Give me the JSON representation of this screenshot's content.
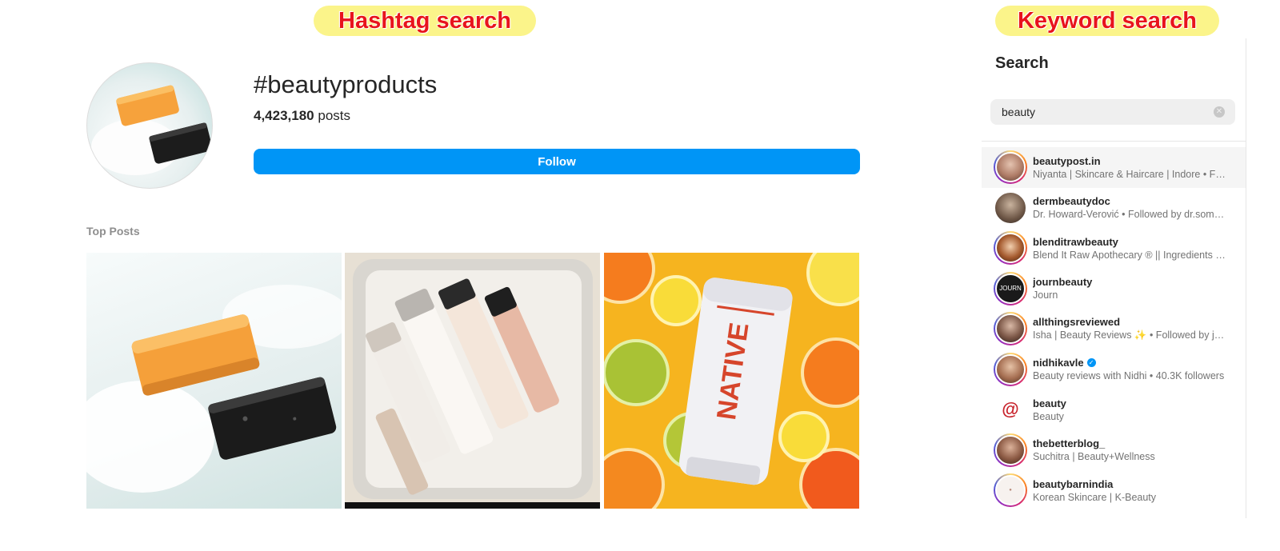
{
  "banners": {
    "hashtag": "Hashtag search",
    "keyword": "Keyword search"
  },
  "hashtag_page": {
    "title": "#beautyproducts",
    "post_count": "4,423,180",
    "post_count_label": "posts",
    "follow_label": "Follow",
    "section_title": "Top Posts",
    "colors": {
      "follow_button": "#0095f6",
      "section_title": "#8e8e8e"
    }
  },
  "search_panel": {
    "heading": "Search",
    "query": "beauty",
    "results": [
      {
        "username": "beautypost.in",
        "subtitle": "Niyanta | Skincare & Haircare | Indore • Foll...",
        "verified": false,
        "avatar_icon": "photo-avatar-icon"
      },
      {
        "username": "dermbeautydoc",
        "subtitle": "Dr. Howard-Verović • Followed by dr.somas...",
        "verified": false,
        "avatar_icon": "photo-avatar-icon"
      },
      {
        "username": "blenditrawbeauty",
        "subtitle": "Blend It Raw Apothecary ® || Ingredients St...",
        "verified": false,
        "avatar_icon": "photo-avatar-icon"
      },
      {
        "username": "journbeauty",
        "subtitle": "Journ",
        "verified": false,
        "avatar_icon": "journ-logo-icon"
      },
      {
        "username": "allthingsreviewed",
        "subtitle": "Isha | Beauty Reviews ✨ • Followed by jhim...",
        "verified": false,
        "avatar_icon": "photo-avatar-icon"
      },
      {
        "username": "nidhikavle",
        "subtitle": "Beauty reviews with Nidhi • 40.3K followers",
        "verified": true,
        "avatar_icon": "photo-avatar-icon"
      },
      {
        "username": "beauty",
        "subtitle": "Beauty",
        "verified": false,
        "avatar_icon": "at-symbol-icon"
      },
      {
        "username": "thebetterblog_",
        "subtitle": "Suchitra | Beauty+Wellness",
        "verified": false,
        "avatar_icon": "photo-avatar-icon"
      },
      {
        "username": "beautybarnindia",
        "subtitle": "Korean Skincare | K-Beauty",
        "verified": false,
        "avatar_icon": "brand-logo-icon"
      }
    ]
  }
}
